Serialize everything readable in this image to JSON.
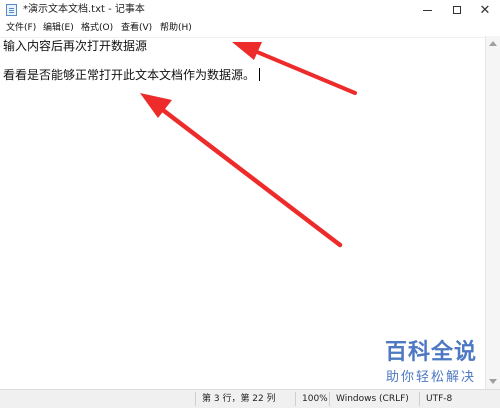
{
  "window": {
    "title": "*演示文本文档.txt - 记事本",
    "controls": {
      "minimize": "minimize",
      "maximize": "maximize",
      "close": "✕"
    }
  },
  "menu": {
    "items": [
      {
        "label": "文件(F)"
      },
      {
        "label": "编辑(E)"
      },
      {
        "label": "格式(O)"
      },
      {
        "label": "查看(V)"
      },
      {
        "label": "帮助(H)"
      }
    ]
  },
  "editor": {
    "lines": [
      "输入内容后再次打开数据源",
      "看看是否能够正常打开此文本文档作为数据源。"
    ]
  },
  "status": {
    "position": "第 3 行，第 22 列",
    "zoom": "100%",
    "line_ending": "Windows (CRLF)",
    "encoding": "UTF-8"
  },
  "watermark": {
    "brand": "百科全说",
    "slogan": "助你轻松解决"
  },
  "colors": {
    "annotation_arrow": "#ee2b2b",
    "watermark": "#4d78c4"
  },
  "icons": {
    "app": "notepad-icon"
  }
}
